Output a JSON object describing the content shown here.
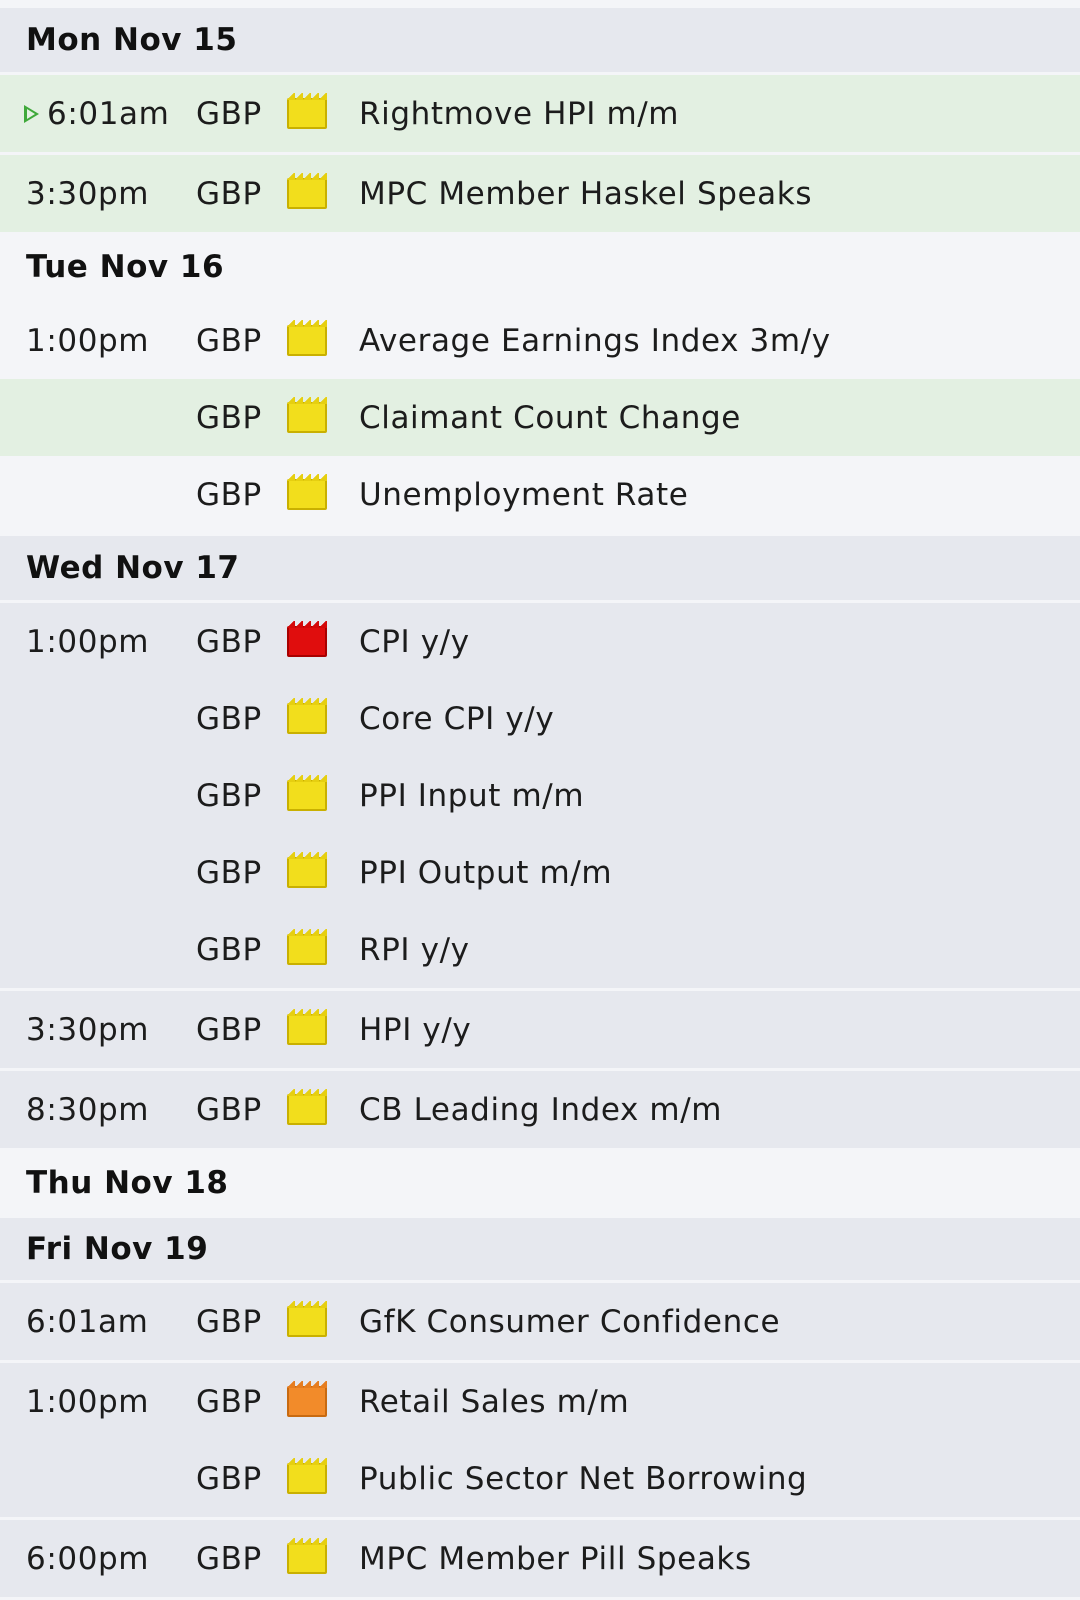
{
  "days": [
    {
      "label": "Mon Nov 15",
      "background": "#e6e8ee",
      "groups": [
        {
          "background": "#e3f0e2",
          "events": [
            {
              "time": "6:01am",
              "currency": "GBP",
              "impact": "low",
              "title": "Rightmove HPI m/m",
              "next_up": true
            }
          ]
        },
        {
          "background": "#e3f0e2",
          "events": [
            {
              "time": "3:30pm",
              "currency": "GBP",
              "impact": "low",
              "title": "MPC Member Haskel Speaks"
            }
          ]
        }
      ]
    },
    {
      "label": "Tue Nov 16",
      "background": "#f4f5f8",
      "groups": [
        {
          "background": "#f4f5f8",
          "events": [
            {
              "time": "1:00pm",
              "currency": "GBP",
              "impact": "low",
              "title": "Average Earnings Index 3m/y",
              "row_background": "#f4f5f8"
            },
            {
              "time": "",
              "currency": "GBP",
              "impact": "low",
              "title": "Claimant Count Change",
              "row_background": "#e3f0e2"
            },
            {
              "time": "",
              "currency": "GBP",
              "impact": "low",
              "title": "Unemployment Rate",
              "row_background": "#f4f5f8"
            }
          ]
        }
      ]
    },
    {
      "label": "Wed Nov 17",
      "background": "#e6e8ee",
      "groups": [
        {
          "background": "#e6e8ee",
          "events": [
            {
              "time": "1:00pm",
              "currency": "GBP",
              "impact": "high",
              "title": "CPI y/y"
            },
            {
              "time": "",
              "currency": "GBP",
              "impact": "low",
              "title": "Core CPI y/y"
            },
            {
              "time": "",
              "currency": "GBP",
              "impact": "low",
              "title": "PPI Input m/m"
            },
            {
              "time": "",
              "currency": "GBP",
              "impact": "low",
              "title": "PPI Output m/m"
            },
            {
              "time": "",
              "currency": "GBP",
              "impact": "low",
              "title": "RPI y/y"
            }
          ]
        },
        {
          "background": "#e6e8ee",
          "events": [
            {
              "time": "3:30pm",
              "currency": "GBP",
              "impact": "low",
              "title": "HPI y/y"
            }
          ]
        },
        {
          "background": "#e6e8ee",
          "events": [
            {
              "time": "8:30pm",
              "currency": "GBP",
              "impact": "low",
              "title": "CB Leading Index m/m"
            }
          ]
        }
      ]
    },
    {
      "label": "Thu Nov 18",
      "background": "#f4f5f8",
      "groups": []
    },
    {
      "label": "Fri Nov 19",
      "background": "#e6e8ee",
      "groups": [
        {
          "background": "#e6e8ee",
          "events": [
            {
              "time": "6:01am",
              "currency": "GBP",
              "impact": "low",
              "title": "GfK Consumer Confidence"
            }
          ]
        },
        {
          "background": "#e6e8ee",
          "events": [
            {
              "time": "1:00pm",
              "currency": "GBP",
              "impact": "medium",
              "title": "Retail Sales m/m"
            },
            {
              "time": "",
              "currency": "GBP",
              "impact": "low",
              "title": "Public Sector Net Borrowing"
            }
          ]
        },
        {
          "background": "#e6e8ee",
          "events": [
            {
              "time": "6:00pm",
              "currency": "GBP",
              "impact": "low",
              "title": "MPC Member Pill Speaks"
            }
          ]
        }
      ]
    }
  ],
  "colors": {
    "page_stripe": "#f4f5f8",
    "impact_low": "#f2de1c",
    "impact_medium": "#f28b2a",
    "impact_high": "#e00d0d",
    "next_marker": "#3fa93a"
  },
  "icons": {
    "impact": "folder-icon",
    "next_up": "play-marker-icon"
  }
}
